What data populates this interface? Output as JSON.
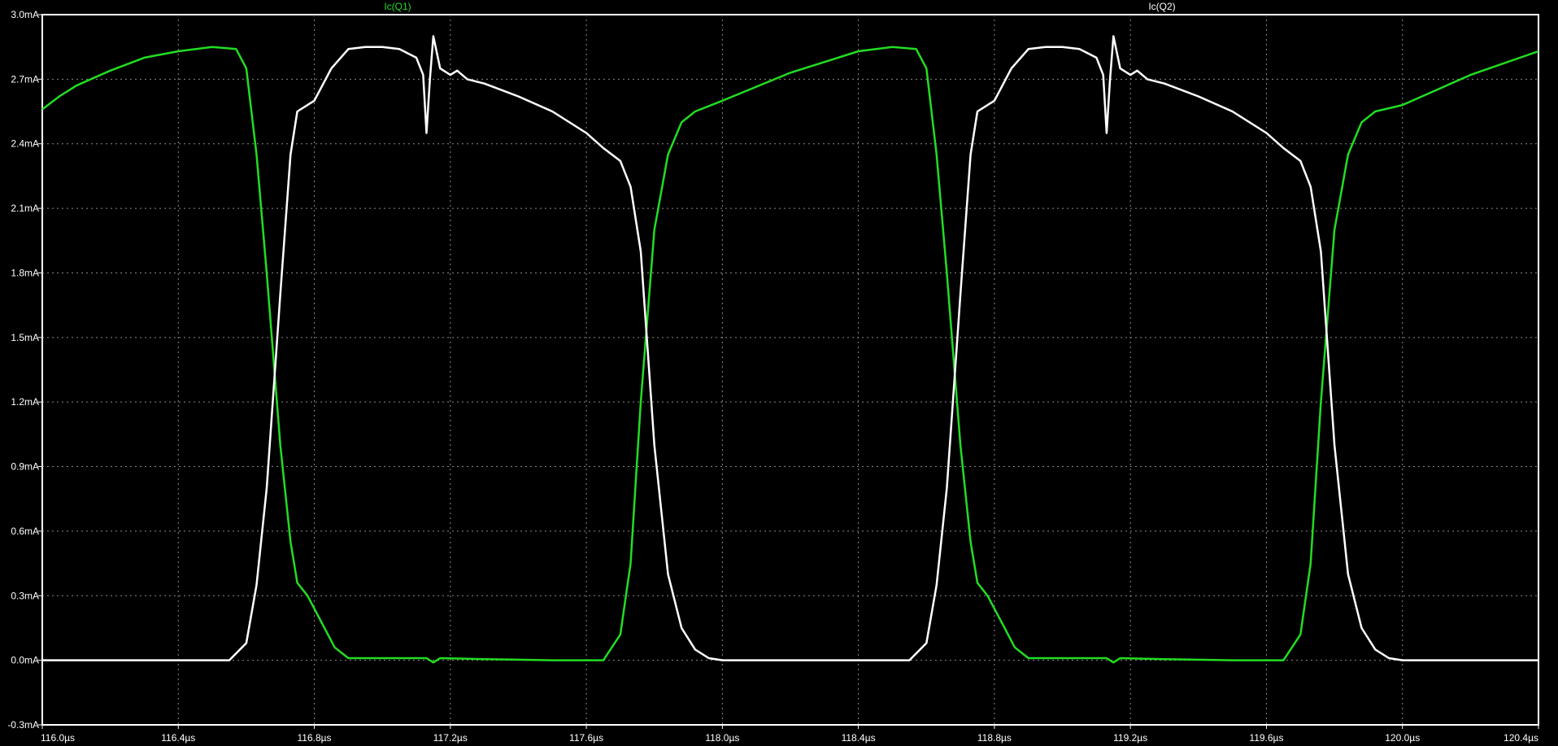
{
  "chart_data": {
    "type": "line",
    "title": "",
    "xlabel": "",
    "ylabel": "",
    "xlim": [
      116.0,
      120.4
    ],
    "ylim": [
      -0.3,
      3.0
    ],
    "x_unit": "µs",
    "y_unit": "mA",
    "grid": true,
    "legend_placement": "top",
    "background": "#000000",
    "x_ticks": [
      "116.0µs",
      "116.4µs",
      "116.8µs",
      "117.2µs",
      "117.6µs",
      "118.0µs",
      "118.4µs",
      "118.8µs",
      "119.2µs",
      "119.6µs",
      "120.0µs",
      "120.4µs"
    ],
    "y_ticks": [
      "3.0mA",
      "2.7mA",
      "2.4mA",
      "2.1mA",
      "1.8mA",
      "1.5mA",
      "1.2mA",
      "0.9mA",
      "0.6mA",
      "0.3mA",
      "0.0mA",
      "-0.3mA"
    ],
    "series": [
      {
        "name": "Ic(Q1)",
        "color": "#22dd22",
        "points": [
          [
            116.0,
            2.56
          ],
          [
            116.05,
            2.62
          ],
          [
            116.1,
            2.67
          ],
          [
            116.2,
            2.74
          ],
          [
            116.3,
            2.8
          ],
          [
            116.4,
            2.83
          ],
          [
            116.5,
            2.85
          ],
          [
            116.57,
            2.84
          ],
          [
            116.6,
            2.75
          ],
          [
            116.63,
            2.35
          ],
          [
            116.66,
            1.8
          ],
          [
            116.7,
            1.0
          ],
          [
            116.73,
            0.55
          ],
          [
            116.75,
            0.36
          ],
          [
            116.78,
            0.3
          ],
          [
            116.82,
            0.18
          ],
          [
            116.86,
            0.06
          ],
          [
            116.9,
            0.01
          ],
          [
            117.0,
            0.01
          ],
          [
            117.13,
            0.01
          ],
          [
            117.15,
            -0.01
          ],
          [
            117.17,
            0.01
          ],
          [
            117.3,
            0.005
          ],
          [
            117.5,
            0.0
          ],
          [
            117.65,
            0.0
          ],
          [
            117.7,
            0.12
          ],
          [
            117.73,
            0.45
          ],
          [
            117.76,
            1.2
          ],
          [
            117.8,
            2.0
          ],
          [
            117.84,
            2.35
          ],
          [
            117.88,
            2.5
          ],
          [
            117.92,
            2.55
          ],
          [
            118.0,
            2.6
          ],
          [
            118.2,
            2.73
          ],
          [
            118.4,
            2.83
          ],
          [
            118.5,
            2.85
          ],
          [
            118.57,
            2.84
          ],
          [
            118.6,
            2.75
          ],
          [
            118.63,
            2.35
          ],
          [
            118.66,
            1.8
          ],
          [
            118.7,
            1.0
          ],
          [
            118.73,
            0.55
          ],
          [
            118.75,
            0.36
          ],
          [
            118.78,
            0.3
          ],
          [
            118.82,
            0.18
          ],
          [
            118.86,
            0.06
          ],
          [
            118.9,
            0.01
          ],
          [
            119.0,
            0.01
          ],
          [
            119.13,
            0.01
          ],
          [
            119.15,
            -0.01
          ],
          [
            119.17,
            0.01
          ],
          [
            119.3,
            0.005
          ],
          [
            119.5,
            0.0
          ],
          [
            119.65,
            0.0
          ],
          [
            119.7,
            0.12
          ],
          [
            119.73,
            0.45
          ],
          [
            119.76,
            1.2
          ],
          [
            119.8,
            2.0
          ],
          [
            119.84,
            2.35
          ],
          [
            119.88,
            2.5
          ],
          [
            119.92,
            2.55
          ],
          [
            120.0,
            2.58
          ],
          [
            120.2,
            2.72
          ],
          [
            120.4,
            2.83
          ]
        ]
      },
      {
        "name": "Ic(Q2)",
        "color": "#ffffff",
        "points": [
          [
            116.0,
            0.0
          ],
          [
            116.3,
            0.0
          ],
          [
            116.55,
            0.0
          ],
          [
            116.6,
            0.08
          ],
          [
            116.63,
            0.35
          ],
          [
            116.66,
            0.8
          ],
          [
            116.7,
            1.7
          ],
          [
            116.73,
            2.35
          ],
          [
            116.75,
            2.55
          ],
          [
            116.8,
            2.6
          ],
          [
            116.85,
            2.75
          ],
          [
            116.9,
            2.84
          ],
          [
            116.95,
            2.85
          ],
          [
            117.0,
            2.85
          ],
          [
            117.05,
            2.84
          ],
          [
            117.1,
            2.8
          ],
          [
            117.12,
            2.72
          ],
          [
            117.13,
            2.45
          ],
          [
            117.14,
            2.7
          ],
          [
            117.15,
            2.9
          ],
          [
            117.17,
            2.75
          ],
          [
            117.2,
            2.72
          ],
          [
            117.22,
            2.74
          ],
          [
            117.25,
            2.7
          ],
          [
            117.3,
            2.68
          ],
          [
            117.4,
            2.62
          ],
          [
            117.5,
            2.55
          ],
          [
            117.6,
            2.45
          ],
          [
            117.65,
            2.38
          ],
          [
            117.7,
            2.32
          ],
          [
            117.73,
            2.2
          ],
          [
            117.76,
            1.9
          ],
          [
            117.8,
            1.0
          ],
          [
            117.84,
            0.4
          ],
          [
            117.88,
            0.15
          ],
          [
            117.92,
            0.05
          ],
          [
            117.96,
            0.01
          ],
          [
            118.0,
            0.0
          ],
          [
            118.3,
            0.0
          ],
          [
            118.55,
            0.0
          ],
          [
            118.6,
            0.08
          ],
          [
            118.63,
            0.35
          ],
          [
            118.66,
            0.8
          ],
          [
            118.7,
            1.7
          ],
          [
            118.73,
            2.35
          ],
          [
            118.75,
            2.55
          ],
          [
            118.8,
            2.6
          ],
          [
            118.85,
            2.75
          ],
          [
            118.9,
            2.84
          ],
          [
            118.95,
            2.85
          ],
          [
            119.0,
            2.85
          ],
          [
            119.05,
            2.84
          ],
          [
            119.1,
            2.8
          ],
          [
            119.12,
            2.72
          ],
          [
            119.13,
            2.45
          ],
          [
            119.14,
            2.7
          ],
          [
            119.15,
            2.9
          ],
          [
            119.17,
            2.75
          ],
          [
            119.2,
            2.72
          ],
          [
            119.22,
            2.74
          ],
          [
            119.25,
            2.7
          ],
          [
            119.3,
            2.68
          ],
          [
            119.4,
            2.62
          ],
          [
            119.5,
            2.55
          ],
          [
            119.6,
            2.45
          ],
          [
            119.65,
            2.38
          ],
          [
            119.7,
            2.32
          ],
          [
            119.73,
            2.2
          ],
          [
            119.76,
            1.9
          ],
          [
            119.8,
            1.0
          ],
          [
            119.84,
            0.4
          ],
          [
            119.88,
            0.15
          ],
          [
            119.92,
            0.05
          ],
          [
            119.96,
            0.01
          ],
          [
            120.0,
            0.0
          ],
          [
            120.4,
            0.0
          ]
        ]
      }
    ]
  }
}
